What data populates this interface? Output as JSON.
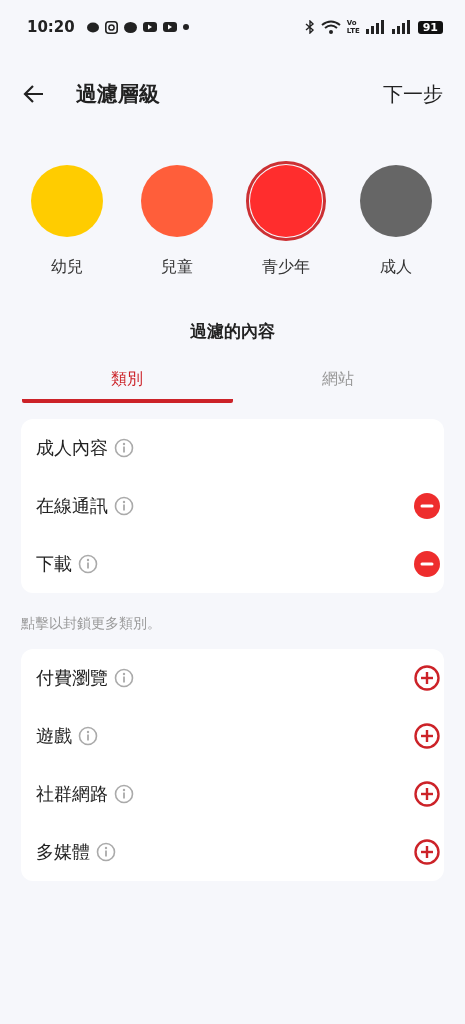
{
  "status_bar": {
    "time": "10:20",
    "network_top": "Vo",
    "network_bottom": "LTE",
    "battery": "91"
  },
  "header": {
    "title": "過濾層級",
    "next": "下一步"
  },
  "levels": [
    {
      "label": "幼兒",
      "color": "#ffcc00",
      "selected": false
    },
    {
      "label": "兒童",
      "color": "#ff5e3a",
      "selected": false
    },
    {
      "label": "青少年",
      "color": "#ff2d2d",
      "selected": true
    },
    {
      "label": "成人",
      "color": "#666666",
      "selected": false
    }
  ],
  "section_title": "過濾的內容",
  "tabs": [
    {
      "label": "類別",
      "selected": true
    },
    {
      "label": "網站",
      "selected": false
    }
  ],
  "blocked": [
    {
      "label": "成人內容",
      "kind": "fixed"
    },
    {
      "label": "在線通訊",
      "kind": "remove"
    },
    {
      "label": "下載",
      "kind": "remove"
    }
  ],
  "hint": "點擊以封鎖更多類別。",
  "available": [
    {
      "label": "付費瀏覽",
      "kind": "add"
    },
    {
      "label": "遊戲",
      "kind": "add"
    },
    {
      "label": "社群網路",
      "kind": "add"
    },
    {
      "label": "多媒體",
      "kind": "add"
    }
  ]
}
